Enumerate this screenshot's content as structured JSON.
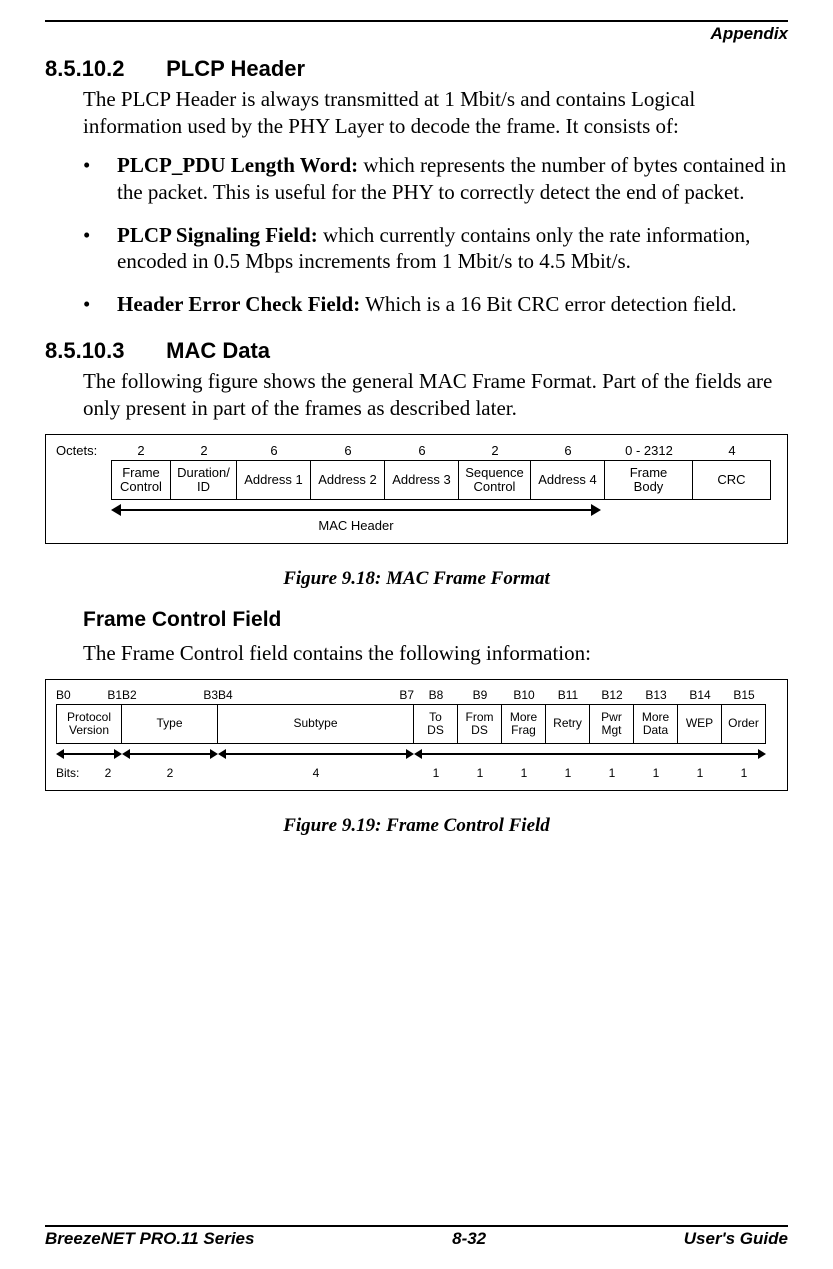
{
  "header": {
    "running_title": "Appendix"
  },
  "section1": {
    "number": "8.5.10.2",
    "title": "PLCP Header",
    "intro": "The PLCP Header is always transmitted at 1 Mbit/s and contains Logical information used by the PHY Layer to decode the frame. It consists of:",
    "bullets": [
      {
        "bold": "PLCP_PDU Length Word:",
        "rest": " which represents the number of bytes contained in the packet. This is useful for the PHY to correctly detect the end of packet."
      },
      {
        "bold": "PLCP Signaling Field:",
        "rest": " which currently contains only the rate information, encoded in 0.5 Mbps increments from 1 Mbit/s to 4.5 Mbit/s."
      },
      {
        "bold": "Header Error Check Field:",
        "rest": " Which is a 16 Bit CRC error detection field."
      }
    ]
  },
  "section2": {
    "number": "8.5.10.3",
    "title": "MAC Data",
    "intro": "The following figure shows the general MAC Frame Format. Part of the fields are only present in part of the frames as described later."
  },
  "chart_data": [
    {
      "type": "table",
      "id": "mac_frame",
      "row_prefix": "Octets:",
      "arrow_label": "MAC Header",
      "caption": "Figure 9.18: MAC Frame Format",
      "columns": [
        {
          "label": "Frame\nControl",
          "octets": "2"
        },
        {
          "label": "Duration/\nID",
          "octets": "2"
        },
        {
          "label": "Address 1",
          "octets": "6"
        },
        {
          "label": "Address 2",
          "octets": "6"
        },
        {
          "label": "Address 3",
          "octets": "6"
        },
        {
          "label": "Sequence\nControl",
          "octets": "2"
        },
        {
          "label": "Address 4",
          "octets": "6"
        },
        {
          "label": "Frame\nBody",
          "octets": "0 - 2312"
        },
        {
          "label": "CRC",
          "octets": "4"
        }
      ],
      "mac_header_span_end_index": 6
    },
    {
      "type": "table",
      "id": "frame_control",
      "heading": "Frame Control Field",
      "intro": "The Frame Control field contains the following information:",
      "top_labels": [
        "B0",
        "B1",
        "B2",
        "B3",
        "B4",
        "B7",
        "B8",
        "B9",
        "B10",
        "B11",
        "B12",
        "B13",
        "B14",
        "B15"
      ],
      "bits_prefix": "Bits:",
      "caption": "Figure 9.19: Frame Control Field",
      "columns": [
        {
          "label": "Protocol\nVersion",
          "bits": "2"
        },
        {
          "label": "Type",
          "bits": "2"
        },
        {
          "label": "Subtype",
          "bits": "4"
        },
        {
          "label": "To\nDS",
          "bits": "1"
        },
        {
          "label": "From\nDS",
          "bits": "1"
        },
        {
          "label": "More\nFrag",
          "bits": "1"
        },
        {
          "label": "Retry",
          "bits": "1"
        },
        {
          "label": "Pwr\nMgt",
          "bits": "1"
        },
        {
          "label": "More\nData",
          "bits": "1"
        },
        {
          "label": "WEP",
          "bits": "1"
        },
        {
          "label": "Order",
          "bits": "1"
        }
      ]
    }
  ],
  "footer": {
    "left": "BreezeNET PRO.11 Series",
    "center": "8-32",
    "right": "User's Guide"
  }
}
